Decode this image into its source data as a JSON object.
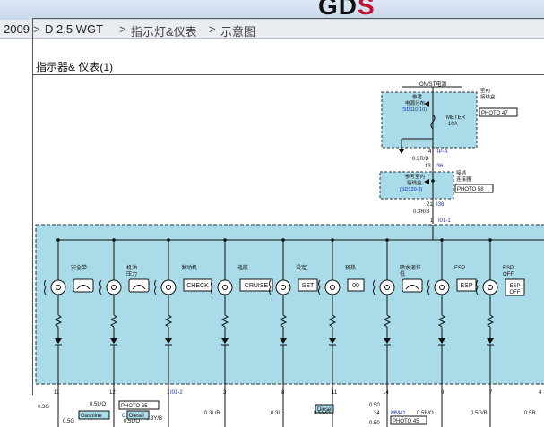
{
  "brand": {
    "logo_main": "GD",
    "logo_accent": "S"
  },
  "breadcrumb": {
    "year": "2009",
    "engine": "D 2.5 WGT",
    "category": "指示灯&仪表",
    "page": "示意图",
    "sep": ">"
  },
  "document": {
    "title": "指示器& 仪表(1)",
    "top": {
      "power_label": "ON/ST电源",
      "ref_fuse_a": "参考",
      "ref_fuse_b": "电源分布",
      "ref_fuse_c": "(SD110-10)",
      "fuse_label": "METER",
      "fuse_amp": "10A",
      "room_a": "室内",
      "room_b": "接线盒",
      "photo_top": "PHOTO 47",
      "pin_4": "4",
      "conn_ipa": "IP-A",
      "wire_1": "0.3R/B",
      "pin_13": "13",
      "conn_i36": "I36",
      "ref_j_a": "参考室内",
      "ref_j_b": "接线盒",
      "ref_j_c": "(SD120-3)",
      "joint_a": "接插",
      "joint_b": "连接器",
      "photo_mid": "PHOTO 58",
      "pin_21": "21",
      "conn_i36b": "I36",
      "wire_2": "0.3R/B",
      "pin_1": "1",
      "conn_i01": "I01-1"
    },
    "indicators": [
      {
        "label": "安全带",
        "icon": "seatbelt-icon"
      },
      {
        "label": "机油\n压力",
        "icon": "oil-pressure-icon"
      },
      {
        "label": "发动机",
        "icon": "check-engine-icon",
        "text": "CHECK"
      },
      {
        "label": "巡航",
        "icon": "cruise-icon",
        "text": "CRUISE"
      },
      {
        "label": "设定",
        "icon": "set-icon",
        "text": "SET"
      },
      {
        "label": "预热",
        "icon": "glow-icon",
        "text": "00"
      },
      {
        "label": "喷水液位\n低",
        "icon": "washer-icon"
      },
      {
        "label": "ESP",
        "icon": "esp-icon",
        "text": "ESP"
      },
      {
        "label": "ESP\nOFF",
        "icon": "esp-off-icon",
        "text": "ESP\nOFF"
      }
    ],
    "bottom": {
      "pins": [
        "11",
        "12",
        "1",
        "3",
        "8",
        "11",
        "14",
        "9",
        "7",
        "4"
      ],
      "conn_i01b": "I01-2",
      "photo65": "PHOTO 65",
      "w_05lo": "0.5L/O",
      "w_12": "12",
      "conn_c111": "C111",
      "w_03yb": "0.3Y/B",
      "w_03g": "0.3G",
      "gasoline": "Gasoline",
      "diesel1": "Diesel",
      "w_05g": "0.5G",
      "w_05lo2": "0.5L/O",
      "w_03lb": "0.3L/B",
      "w_03l": "0.3L",
      "diesel2": "Diesel",
      "w_05yo": "0.5Y/O",
      "w_050a": "0.50",
      "w_34": "34",
      "conn_mm1": "MM41",
      "w_05bo": "0.5B/O",
      "photo45": "PHOTO 45",
      "w_05gb": "0.5G/B",
      "w_05r": "0.5R",
      "w_050b": "0.50",
      "w_21": "21",
      "conn_em11": "EM11",
      "photo15": "PHOTO 15",
      "w_050c": "0.50"
    }
  },
  "colors": {
    "fill": "#a9dbe8",
    "line": "#1a1a1a",
    "blue": "#1b2fa8",
    "photo_bg": "#fff",
    "tag_bg": "#a9dbe8"
  }
}
